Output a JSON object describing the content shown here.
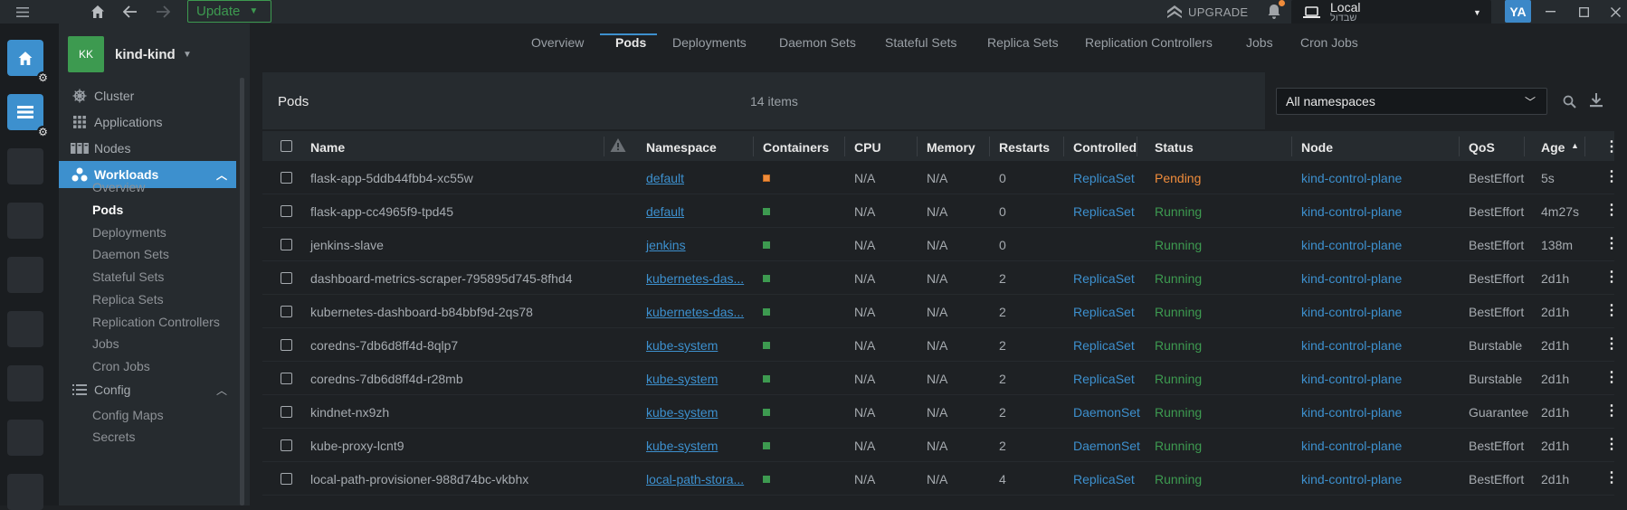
{
  "topbar": {
    "update_label": "Update",
    "upgrade_label": "UPGRADE",
    "context_name": "Local",
    "context_sub": "שבדול",
    "avatar": "YA"
  },
  "hotbar": {
    "items": [
      "home",
      "workloads"
    ]
  },
  "cluster": {
    "badge": "KK",
    "name": "kind-kind"
  },
  "sidebar": {
    "items": [
      {
        "label": "Cluster",
        "icon": "helm-icon"
      },
      {
        "label": "Applications",
        "icon": "apps-grid-icon"
      },
      {
        "label": "Nodes",
        "icon": "nodes-icon"
      },
      {
        "label": "Workloads",
        "icon": "workloads-icon"
      },
      {
        "label": "Config",
        "icon": "list-icon"
      }
    ],
    "workloads_sub": [
      "Overview",
      "Pods",
      "Deployments",
      "Daemon Sets",
      "Stateful Sets",
      "Replica Sets",
      "Replication Controllers",
      "Jobs",
      "Cron Jobs"
    ],
    "config_sub": [
      "Config Maps",
      "Secrets"
    ]
  },
  "tabs": [
    "Overview",
    "Pods",
    "Deployments",
    "Daemon Sets",
    "Stateful Sets",
    "Replica Sets",
    "Replication Controllers",
    "Jobs",
    "Cron Jobs"
  ],
  "panel": {
    "title": "Pods",
    "count": "14 items",
    "namespace_filter": "All namespaces"
  },
  "table": {
    "columns": [
      "Name",
      "Namespace",
      "Containers",
      "CPU",
      "Memory",
      "Restarts",
      "Controlled",
      "Status",
      "Node",
      "QoS",
      "Age"
    ],
    "rows": [
      {
        "name": "flask-app-5ddb44fbb4-xc55w",
        "namespace": "default",
        "container": "pending",
        "cpu": "N/A",
        "memory": "N/A",
        "restarts": "0",
        "controlled": "ReplicaSet",
        "status": "Pending",
        "node": "kind-control-plane",
        "qos": "BestEffort",
        "age": "5s"
      },
      {
        "name": "flask-app-cc4965f9-tpd45",
        "namespace": "default",
        "container": "running",
        "cpu": "N/A",
        "memory": "N/A",
        "restarts": "0",
        "controlled": "ReplicaSet",
        "status": "Running",
        "node": "kind-control-plane",
        "qos": "BestEffort",
        "age": "4m27s"
      },
      {
        "name": "jenkins-slave",
        "namespace": "jenkins",
        "container": "running",
        "cpu": "N/A",
        "memory": "N/A",
        "restarts": "0",
        "controlled": "",
        "status": "Running",
        "node": "kind-control-plane",
        "qos": "BestEffort",
        "age": "138m"
      },
      {
        "name": "dashboard-metrics-scraper-795895d745-8fhd4",
        "namespace": "kubernetes-das...",
        "container": "running",
        "cpu": "N/A",
        "memory": "N/A",
        "restarts": "2",
        "controlled": "ReplicaSet",
        "status": "Running",
        "node": "kind-control-plane",
        "qos": "BestEffort",
        "age": "2d1h"
      },
      {
        "name": "kubernetes-dashboard-b84bbf9d-2qs78",
        "namespace": "kubernetes-das...",
        "container": "running",
        "cpu": "N/A",
        "memory": "N/A",
        "restarts": "2",
        "controlled": "ReplicaSet",
        "status": "Running",
        "node": "kind-control-plane",
        "qos": "BestEffort",
        "age": "2d1h"
      },
      {
        "name": "coredns-7db6d8ff4d-8qlp7",
        "namespace": "kube-system",
        "container": "running",
        "cpu": "N/A",
        "memory": "N/A",
        "restarts": "2",
        "controlled": "ReplicaSet",
        "status": "Running",
        "node": "kind-control-plane",
        "qos": "Burstable",
        "age": "2d1h"
      },
      {
        "name": "coredns-7db6d8ff4d-r28mb",
        "namespace": "kube-system",
        "container": "running",
        "cpu": "N/A",
        "memory": "N/A",
        "restarts": "2",
        "controlled": "ReplicaSet",
        "status": "Running",
        "node": "kind-control-plane",
        "qos": "Burstable",
        "age": "2d1h"
      },
      {
        "name": "kindnet-nx9zh",
        "namespace": "kube-system",
        "container": "running",
        "cpu": "N/A",
        "memory": "N/A",
        "restarts": "2",
        "controlled": "DaemonSet",
        "status": "Running",
        "node": "kind-control-plane",
        "qos": "Guarantee",
        "age": "2d1h"
      },
      {
        "name": "kube-proxy-lcnt9",
        "namespace": "kube-system",
        "container": "running",
        "cpu": "N/A",
        "memory": "N/A",
        "restarts": "2",
        "controlled": "DaemonSet",
        "status": "Running",
        "node": "kind-control-plane",
        "qos": "BestEffort",
        "age": "2d1h"
      },
      {
        "name": "local-path-provisioner-988d74bc-vkbhx",
        "namespace": "local-path-stora...",
        "container": "running",
        "cpu": "N/A",
        "memory": "N/A",
        "restarts": "4",
        "controlled": "ReplicaSet",
        "status": "Running",
        "node": "kind-control-plane",
        "qos": "BestEffort",
        "age": "2d1h"
      }
    ]
  },
  "colors": {
    "accent": "#3d90ce",
    "running": "#3d9a50",
    "pending": "#f08c3b",
    "notification_dot": "#f08c3b"
  }
}
